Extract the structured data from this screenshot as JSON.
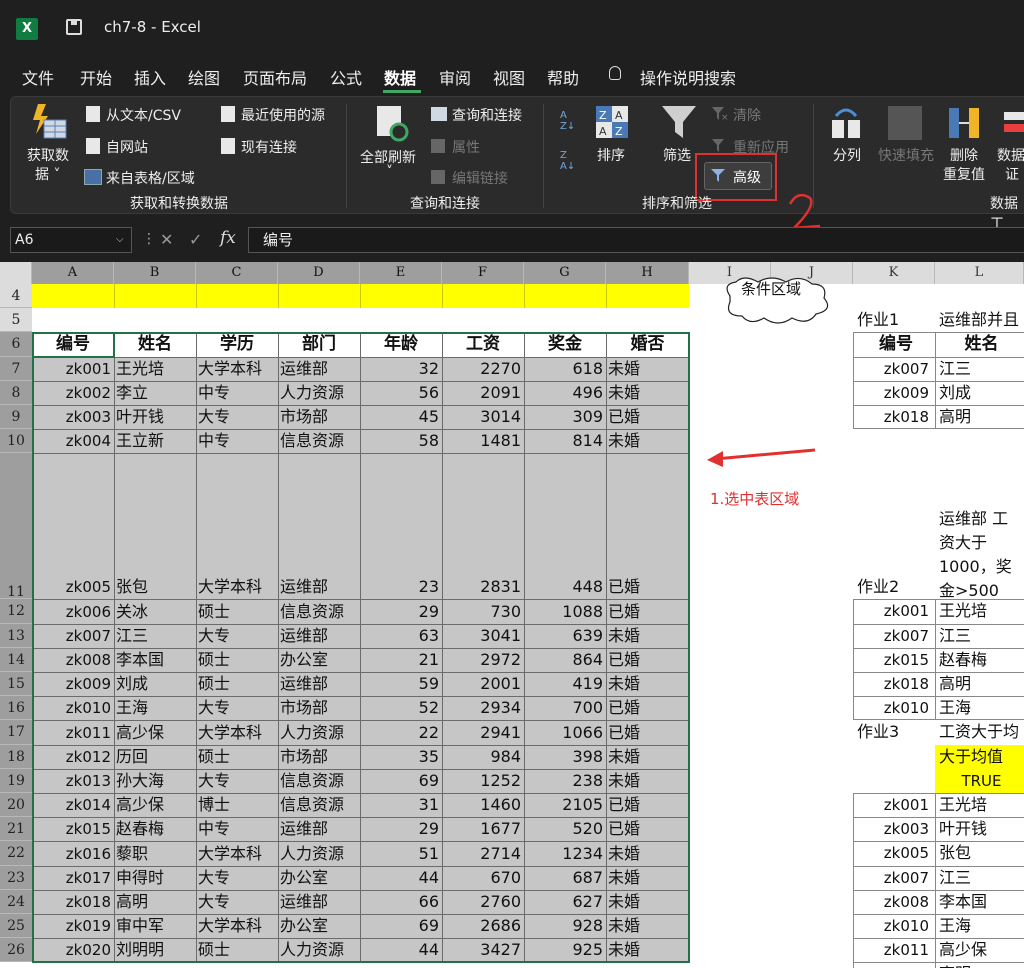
{
  "window": {
    "title": "ch7-8  -  Excel",
    "app_icon": "excel-icon"
  },
  "menu": [
    "文件",
    "开始",
    "插入",
    "绘图",
    "页面布局",
    "公式",
    "数据",
    "审阅",
    "视图",
    "帮助",
    "操作说明搜索"
  ],
  "ribbon": {
    "get_data": "获取数\n据",
    "get_data_line1": "获取数",
    "get_data_line2": "据 ˅",
    "from_text": "从文本/CSV",
    "from_web": "自网站",
    "from_table": "来自表格/区域",
    "recent_sources": "最近使用的源",
    "existing_conn": "现有连接",
    "group1": "获取和转换数据",
    "refresh_all_line1": "全部刷新",
    "refresh_all_line2": "˅",
    "queries_conn": "查询和连接",
    "properties": "属性",
    "edit_links": "编辑链接",
    "group2": "查询和连接",
    "sort": "排序",
    "filter": "筛选",
    "clear": "清除",
    "reapply": "重新应用",
    "advanced": "高级",
    "group3": "排序和筛选",
    "text_to_cols": "分列",
    "flash_fill": "快速填充",
    "remove_dup_line1": "删除",
    "remove_dup_line2": "重复值",
    "data_valid_line1": "数据",
    "data_valid_line2": "证",
    "group4": "数据工"
  },
  "formula_bar": {
    "name_box": "A6",
    "formula": "编号"
  },
  "annotations": {
    "arrow_label": "1.选中表区域",
    "number_mark": "2",
    "cloud_label": "条件区域"
  },
  "sheet": {
    "columns": [
      "A",
      "B",
      "C",
      "D",
      "E",
      "F",
      "G",
      "H",
      "I",
      "J",
      "K",
      "L"
    ],
    "rows": [
      "4",
      "5",
      "6",
      "7",
      "8",
      "9",
      "10",
      "11",
      "12",
      "13",
      "14",
      "15",
      "16",
      "17",
      "18",
      "19",
      "20",
      "21",
      "22",
      "23",
      "24",
      "25",
      "26"
    ],
    "header": [
      "编号",
      "姓名",
      "学历",
      "部门",
      "年龄",
      "工资",
      "奖金",
      "婚否"
    ],
    "data": [
      [
        "zk001",
        "王光培",
        "大学本科",
        "运维部",
        "32",
        "2270",
        "618",
        "未婚"
      ],
      [
        "zk002",
        "李立",
        "中专",
        "人力资源",
        "56",
        "2091",
        "496",
        "未婚"
      ],
      [
        "zk003",
        "叶开钱",
        "大专",
        "市场部",
        "45",
        "3014",
        "309",
        "已婚"
      ],
      [
        "zk004",
        "王立新",
        "中专",
        "信息资源",
        "58",
        "1481",
        "814",
        "未婚"
      ],
      [
        "zk005",
        "张包",
        "大学本科",
        "运维部",
        "23",
        "2831",
        "448",
        "已婚"
      ],
      [
        "zk006",
        "关冰",
        "硕士",
        "信息资源",
        "29",
        "730",
        "1088",
        "已婚"
      ],
      [
        "zk007",
        "江三",
        "大专",
        "运维部",
        "63",
        "3041",
        "639",
        "未婚"
      ],
      [
        "zk008",
        "李本国",
        "硕士",
        "办公室",
        "21",
        "2972",
        "864",
        "已婚"
      ],
      [
        "zk009",
        "刘成",
        "硕士",
        "运维部",
        "59",
        "2001",
        "419",
        "未婚"
      ],
      [
        "zk010",
        "王海",
        "大专",
        "市场部",
        "52",
        "2934",
        "700",
        "已婚"
      ],
      [
        "zk011",
        "高少保",
        "大学本科",
        "人力资源",
        "22",
        "2941",
        "1066",
        "已婚"
      ],
      [
        "zk012",
        "历回",
        "硕士",
        "市场部",
        "35",
        "984",
        "398",
        "未婚"
      ],
      [
        "zk013",
        "孙大海",
        "大专",
        "信息资源",
        "69",
        "1252",
        "238",
        "未婚"
      ],
      [
        "zk014",
        "高少保",
        "博士",
        "信息资源",
        "31",
        "1460",
        "2105",
        "已婚"
      ],
      [
        "zk015",
        "赵春梅",
        "中专",
        "运维部",
        "29",
        "1677",
        "520",
        "已婚"
      ],
      [
        "zk016",
        "藜职",
        "大学本科",
        "人力资源",
        "51",
        "2714",
        "1234",
        "未婚"
      ],
      [
        "zk017",
        "申得时",
        "大专",
        "办公室",
        "44",
        "670",
        "687",
        "未婚"
      ],
      [
        "zk018",
        "高明",
        "大专",
        "运维部",
        "66",
        "2760",
        "627",
        "未婚"
      ],
      [
        "zk019",
        "审中军",
        "大学本科",
        "办公室",
        "69",
        "2686",
        "928",
        "未婚"
      ],
      [
        "zk020",
        "刘明明",
        "硕士",
        "人力资源",
        "44",
        "3427",
        "925",
        "未婚"
      ]
    ],
    "side": {
      "k5": "作业1",
      "l5": "运维部并且",
      "k6": "编号",
      "l6": "姓名",
      "h1": [
        [
          "zk007",
          "江三"
        ],
        [
          "zk009",
          "刘成"
        ],
        [
          "zk018",
          "高明"
        ]
      ],
      "l11": [
        "运维部 工",
        "资大于",
        "1000，奖",
        "金>500"
      ],
      "k11": "作业2",
      "h2": [
        [
          "zk001",
          "王光培"
        ],
        [
          "zk007",
          "江三"
        ],
        [
          "zk015",
          "赵春梅"
        ],
        [
          "zk018",
          "高明"
        ],
        [
          "zk010",
          "王海"
        ]
      ],
      "k17": "作业3",
      "l17": "工资大于均",
      "l18": "大于均值",
      "l19": "TRUE",
      "h3": [
        [
          "zk001",
          "王光培"
        ],
        [
          "zk003",
          "叶开钱"
        ],
        [
          "zk005",
          "张包"
        ],
        [
          "zk007",
          "江三"
        ],
        [
          "zk008",
          "李本国"
        ],
        [
          "zk010",
          "王海"
        ],
        [
          "zk011",
          "高少保"
        ]
      ],
      "partial_bottom": "高明"
    }
  },
  "colors": {
    "excel_green": "#107c41",
    "selection_gray": "#c6c6c6",
    "yellow": "#ffff00",
    "red": "#e03030"
  }
}
